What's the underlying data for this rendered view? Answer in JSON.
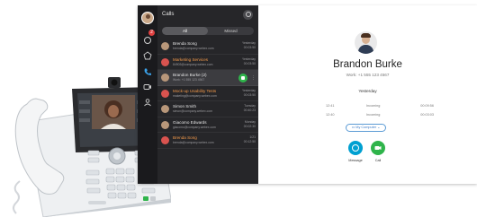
{
  "app": {
    "list_title": "Calls",
    "rail_badge": "2",
    "tabs": [
      {
        "label": "All",
        "active": true
      },
      {
        "label": "Missed",
        "active": false
      }
    ],
    "calls": [
      {
        "name": "Brenda Song",
        "email": "brenda@company.webex.com",
        "meta1": "Yesterday",
        "meta2": "00:03:50",
        "missed": false,
        "icon": "avatar-photo",
        "selected": false
      },
      {
        "name": "Marketing Services",
        "email": "84903@company.webex.com",
        "meta1": "Yesterday",
        "meta2": "00:03:50",
        "missed": true,
        "icon": "missed-call-icon",
        "selected": false
      },
      {
        "name": "Brandon Burke (2)",
        "email": "Work: +1 555 123 4567",
        "meta1": "",
        "meta2": "",
        "missed": false,
        "icon": "avatar-photo",
        "selected": true
      },
      {
        "name": "Mock-up Usability Tests",
        "email": "maketing@company.webex.com",
        "meta1": "Yesterday",
        "meta2": "00:03:50",
        "missed": true,
        "icon": "missed-call-icon",
        "selected": false
      },
      {
        "name": "Simon Smith",
        "email": "simon@company.webex.com",
        "meta1": "Tuesday",
        "meta2": "00:40:23",
        "missed": false,
        "icon": "avatar-photo",
        "selected": false
      },
      {
        "name": "Giacomo Edwards",
        "email": "giacomo@company.webex.com",
        "meta1": "Monday",
        "meta2": "00:02:30",
        "missed": false,
        "icon": "avatar-photo",
        "selected": false
      },
      {
        "name": "Brenda Song",
        "email": "brenda@company.webex.com",
        "meta1": "1/21",
        "meta2": "00:12:50",
        "missed": true,
        "icon": "missed-call-icon",
        "selected": false
      }
    ],
    "contact": {
      "name": "Brandon Burke",
      "work": "Work: +1 555 123 4567",
      "day_label": "Yesterday",
      "history": [
        {
          "time": "12:41",
          "type": "Incoming",
          "duration": "00:09:56"
        },
        {
          "time": "12:40",
          "type": "Incoming",
          "duration": "00:03:03"
        }
      ],
      "device_selector": "My Computer",
      "actions": [
        {
          "label": "Message",
          "color": "#00a0d1"
        },
        {
          "label": "Call",
          "color": "#2fb44b"
        }
      ]
    }
  },
  "colors": {
    "rail_bg": "#1a1a1d",
    "list_bg": "#262629",
    "missed": "#f2994a",
    "call_green": "#2fb44b",
    "message_blue": "#00a0d1"
  }
}
